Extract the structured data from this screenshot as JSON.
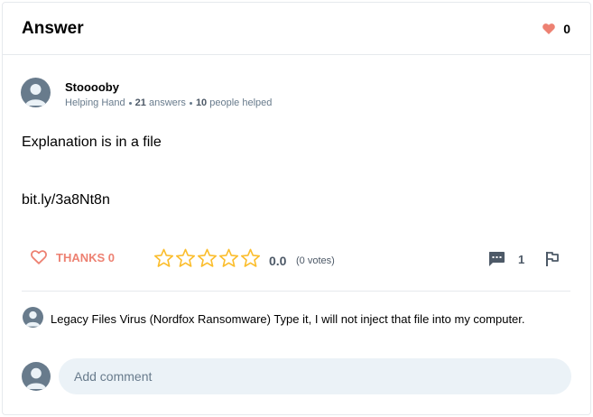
{
  "header": {
    "title": "Answer",
    "likes_count": "0"
  },
  "author": {
    "name": "Stooooby",
    "rank": "Helping Hand",
    "answers_count": "21",
    "answers_label": "answers",
    "helped_count": "10",
    "helped_label": "people helped"
  },
  "answer": {
    "line1": "Explanation is in a file",
    "line2": "bit.ly/3a8Nt8n"
  },
  "actions": {
    "thanks_label": "THANKS 0",
    "rating_value": "0.0",
    "votes_label": "(0 votes)",
    "stars_filled": 0,
    "stars_total": 5,
    "comments_count": "1"
  },
  "comments": [
    {
      "text": "Legacy Files Virus (Nordfox Ransomware) Type it, I will not inject that file into my computer."
    }
  ],
  "add_comment": {
    "placeholder": "Add comment"
  },
  "colors": {
    "accent_heart": "#ed8172",
    "star": "#fbbe2e",
    "muted": "#687b8c",
    "input_bg": "#ebf2f7"
  },
  "icons": {
    "likes": "heart-icon",
    "thanks": "heart-outline-icon",
    "rating": "star-icon",
    "comments": "comment-icon",
    "report": "flag-icon",
    "avatar": "user-avatar-icon"
  }
}
